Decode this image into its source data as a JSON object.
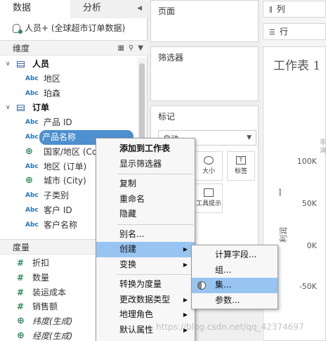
{
  "tabs": {
    "data": "数据",
    "analysis": "分析"
  },
  "source": {
    "label": "人员+ (全球超市订单数据)"
  },
  "dimensions": {
    "header": "维度",
    "groups": [
      {
        "label": "人员",
        "fields": [
          {
            "type": "Abc",
            "label": "地区"
          },
          {
            "type": "Abc",
            "label": "珀森"
          }
        ]
      },
      {
        "label": "订单",
        "fields": [
          {
            "type": "Abc",
            "label": "产品 ID"
          },
          {
            "type": "Abc",
            "label": "产品名称"
          },
          {
            "type": "globe",
            "label": "国家/地区 (Co"
          },
          {
            "type": "Abc",
            "label": "地区 (订单)"
          },
          {
            "type": "globe",
            "label": "城市 (City)"
          },
          {
            "type": "Abc",
            "label": "子类别"
          },
          {
            "type": "Abc",
            "label": "客户 ID"
          },
          {
            "type": "Abc",
            "label": "客户名称"
          }
        ]
      }
    ]
  },
  "measures": {
    "header": "度量",
    "fields": [
      {
        "type": "#",
        "label": "折扣"
      },
      {
        "type": "#",
        "label": "数量"
      },
      {
        "type": "#",
        "label": "装运成本"
      },
      {
        "type": "#",
        "label": "销售额"
      },
      {
        "type": "globe",
        "label": "纬度(生成)"
      },
      {
        "type": "globe",
        "label": "经度(生成)"
      }
    ]
  },
  "shelves": {
    "pages": "页面",
    "filters": "筛选器",
    "marks": "标记",
    "marks_dropdown": "自动",
    "size": "大小",
    "label": "标签",
    "tooltip": "工具提示",
    "columns": "列",
    "rows": "行"
  },
  "view": {
    "title": "工作表 1",
    "y_axis_title": "利润",
    "y_ticks": [
      "100K",
      "50K",
      "0K",
      "-50K"
    ],
    "clipped": "非\n消"
  },
  "context_menu": {
    "items": [
      "添加到工作表",
      "显示筛选器",
      "复制",
      "重命名",
      "隐藏",
      "别名...",
      "创建",
      "变换",
      "转换为度量",
      "更改数据类型",
      "地理角色",
      "默认属性"
    ]
  },
  "submenu": {
    "items": [
      "计算字段...",
      "组...",
      "集...",
      "参数..."
    ]
  },
  "watermark": "https://blog.csdn.net/qq_42374697"
}
